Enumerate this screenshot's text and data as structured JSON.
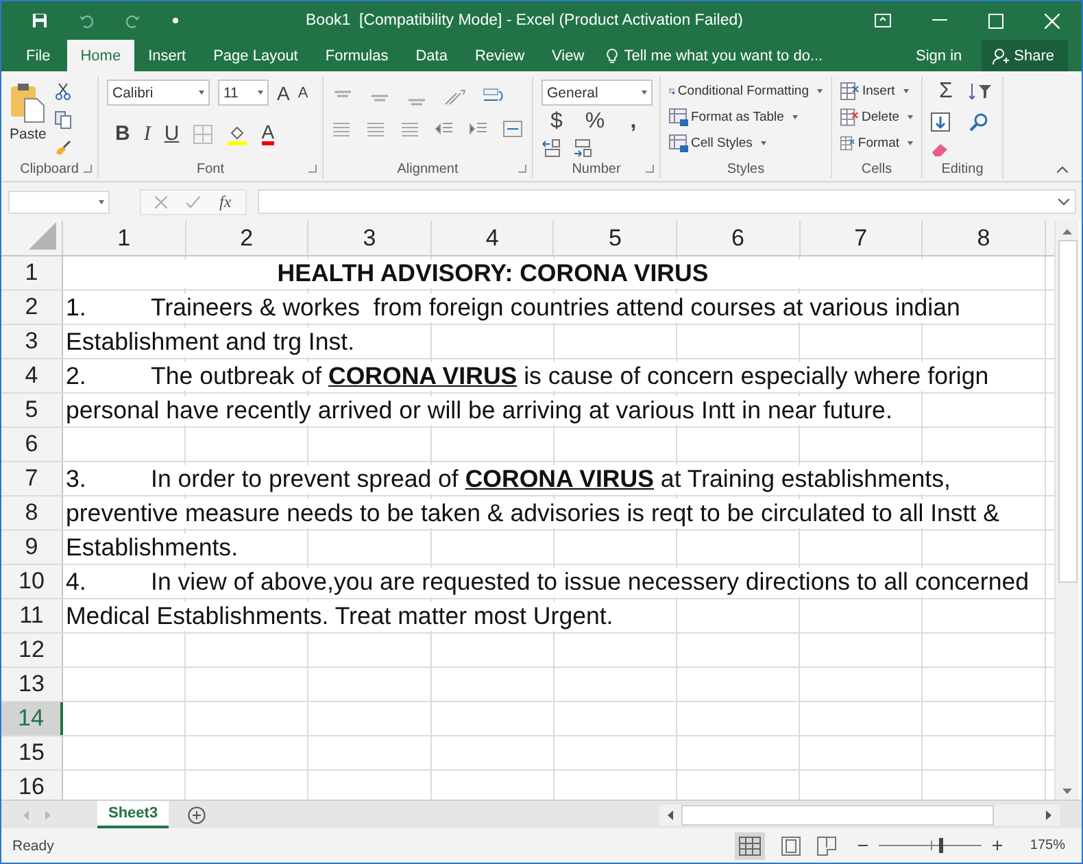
{
  "window": {
    "title": "Book1  [Compatibility Mode] - Excel (Product Activation Failed)"
  },
  "tabs": [
    {
      "label": "File",
      "selected": false
    },
    {
      "label": "Home",
      "selected": true
    },
    {
      "label": "Insert",
      "selected": false
    },
    {
      "label": "Page Layout",
      "selected": false
    },
    {
      "label": "Formulas",
      "selected": false
    },
    {
      "label": "Data",
      "selected": false
    },
    {
      "label": "Review",
      "selected": false
    },
    {
      "label": "View",
      "selected": false
    }
  ],
  "tell_me": {
    "placeholder": "Tell me what you want to do..."
  },
  "sign_in": "Sign in",
  "share": "Share",
  "ribbon": {
    "clipboard": {
      "paste": "Paste",
      "label": "Clipboard"
    },
    "font": {
      "family": "Calibri",
      "size": "11",
      "grow": "A",
      "shrink": "A",
      "bold": "B",
      "italic": "I",
      "underline": "U",
      "color_button": "A",
      "label": "Font"
    },
    "alignment": {
      "label": "Alignment"
    },
    "number": {
      "format": "General",
      "currency": "$",
      "percent": "%",
      "comma": ",",
      "label": "Number"
    },
    "styles": {
      "buttons": [
        "Conditional Formatting",
        "Format as Table",
        "Cell Styles"
      ],
      "label": "Styles"
    },
    "cells": {
      "buttons": [
        "Insert",
        "Delete",
        "Format"
      ],
      "label": "Cells"
    },
    "editing": {
      "sum": "Σ",
      "label": "Editing"
    }
  },
  "formula_bar": {
    "fx": "fx"
  },
  "columns": [
    "1",
    "2",
    "3",
    "4",
    "5",
    "6",
    "7",
    "8"
  ],
  "rows": [
    {
      "header": "1",
      "selected": false,
      "kind": "title",
      "text": "HEALTH ADVISORY: CORONA VIRUS"
    },
    {
      "header": "2",
      "selected": false,
      "kind": "item",
      "label": "1.",
      "text": "Traineers & workes  from foreign countries attend courses at various indian"
    },
    {
      "header": "3",
      "selected": false,
      "kind": "plain",
      "text": "Establishment and trg Inst."
    },
    {
      "header": "4",
      "selected": false,
      "kind": "item",
      "label": "2.",
      "text": "The outbreak of **CORONA VIRUS** is cause of concern especially where forign"
    },
    {
      "header": "5",
      "selected": false,
      "kind": "plain",
      "text": "personal have recently arrived or will be arriving at various Intt in near future."
    },
    {
      "header": "6",
      "selected": false,
      "kind": "empty"
    },
    {
      "header": "7",
      "selected": false,
      "kind": "item",
      "label": "3.",
      "text": "In order to prevent spread of **CORONA VIRUS** at Training establishments,"
    },
    {
      "header": "8",
      "selected": false,
      "kind": "plain",
      "text": "preventive measure needs to be taken & advisories is reqt to be circulated to all Instt &"
    },
    {
      "header": "9",
      "selected": false,
      "kind": "plain",
      "text": "Establishments."
    },
    {
      "header": "10",
      "selected": false,
      "kind": "item",
      "label": "4.",
      "text": "In view of above,you are requested to issue necessery directions to all concerned"
    },
    {
      "header": "11",
      "selected": false,
      "kind": "plain",
      "text": "Medical Establishments. Treat matter most Urgent."
    },
    {
      "header": "12",
      "selected": false,
      "kind": "empty"
    },
    {
      "header": "13",
      "selected": false,
      "kind": "empty"
    },
    {
      "header": "14",
      "selected": true,
      "kind": "empty"
    },
    {
      "header": "15",
      "selected": false,
      "kind": "empty"
    },
    {
      "header": "16",
      "selected": false,
      "kind": "empty"
    }
  ],
  "sheets": [
    {
      "label": "Sheet3",
      "selected": true
    }
  ],
  "status": {
    "text": "Ready",
    "zoom": "175%",
    "level": 0.6
  }
}
